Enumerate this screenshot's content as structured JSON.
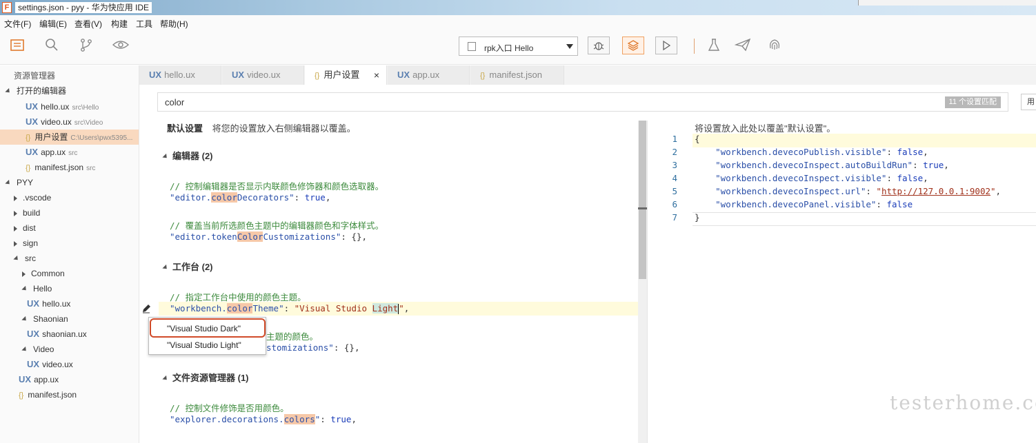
{
  "window": {
    "title": "settings.json - pyy - 华为快应用 IDE",
    "app_icon": "F"
  },
  "menu": [
    "文件(F)",
    "编辑(E)",
    "查看(V)",
    "构建",
    "工具",
    "帮助(H)"
  ],
  "toolbar": {
    "run_target": "rpk入口 Hello",
    "icons": [
      "explorer-icon",
      "search-icon",
      "source-control-icon",
      "preview-eye-icon",
      "debug-bug-icon",
      "layers-icon",
      "run-play-icon",
      "flask-icon",
      "send-icon",
      "fingerprint-icon"
    ]
  },
  "sidebar": {
    "title": "资源管理器",
    "open_editors_label": "打开的编辑器",
    "open_editors": [
      {
        "type": "ux",
        "name": "hello.ux",
        "hint": "src\\Hello"
      },
      {
        "type": "ux",
        "name": "video.ux",
        "hint": "src\\Video"
      },
      {
        "type": "json",
        "name": "用户设置",
        "hint": "C:\\Users\\pwx5395..."
      },
      {
        "type": "ux",
        "name": "app.ux",
        "hint": "src"
      },
      {
        "type": "json",
        "name": "manifest.json",
        "hint": "src"
      }
    ],
    "project": "PYY",
    "tree": [
      ".vscode",
      "build",
      "dist",
      "sign",
      "src",
      "Common",
      "Hello",
      "hello.ux",
      "Shaonian",
      "shaonian.ux",
      "Video",
      "video.ux",
      "app.ux",
      "manifest.json"
    ]
  },
  "tabs": [
    {
      "type": "ux",
      "label": "hello.ux"
    },
    {
      "type": "ux",
      "label": "video.ux"
    },
    {
      "type": "json",
      "label": "用户设置"
    },
    {
      "type": "ux",
      "label": "app.ux"
    },
    {
      "type": "json",
      "label": "manifest.json"
    }
  ],
  "close_glyph": "×",
  "search": {
    "value": "color",
    "badge": "11 个设置匹配",
    "right_button": "用"
  },
  "left_editor": {
    "header_bold": "默认设置",
    "header_text": "将您的设置放入右侧编辑器以覆盖。",
    "sections": [
      {
        "title": "编辑器 (2)"
      },
      {
        "title": "工作台 (2)"
      },
      {
        "title": "文件资源管理器 (1)"
      }
    ],
    "comments": [
      "// 控制编辑器是否显示内联颜色修饰器和颜色选取器。",
      "// 覆盖当前所选颜色主题中的编辑器颜色和字体样式。",
      "// 指定工作台中使用的颜色主题。",
      "主题的颜色。",
      "// 控制文件修饰是否用颜色。"
    ],
    "code": {
      "l1_key_a": "\"editor.",
      "l1_hl": "color",
      "l1_key_b": "Decorators\"",
      "l1_rest": ": ",
      "l1_val": "true",
      "l1_end": ",",
      "l2_key_a": "\"editor.token",
      "l2_hl": "Color",
      "l2_key_b": "Customizations\"",
      "l2_rest": ": {},",
      "l3_key_a": "\"workbench.",
      "l3_hl": "color",
      "l3_key_b": "Theme\"",
      "l3_rest": ": ",
      "l3_str_a": "\"Visual Studio ",
      "l3_str_hl": "Light",
      "l3_str_b": "\"",
      "l3_end": ",",
      "l4_key": "stomizations\"",
      "l4_rest": ": {},",
      "l5_key_a": "\"explorer.decorations.",
      "l5_hl": "colors",
      "l5_key_b": "\"",
      "l5_rest": ": ",
      "l5_val": "true",
      "l5_end": ","
    }
  },
  "dropdown": {
    "options": [
      "\"Visual Studio Dark\"",
      "\"Visual Studio Light\""
    ],
    "selected": 0
  },
  "right_editor": {
    "header": "将设置放入此处以覆盖\"默认设置\"。",
    "line_numbers": [
      "1",
      "2",
      "3",
      "4",
      "5",
      "6",
      "7"
    ],
    "open_brace": "{",
    "close_brace": "}",
    "entries": [
      {
        "key": "\"workbench.devecoPublish.visible\"",
        "value": "false",
        "comma": ","
      },
      {
        "key": "\"workbench.devecoInspect.autoBuildRun\"",
        "value": "true",
        "comma": ","
      },
      {
        "key": "\"workbench.devecoInspect.visible\"",
        "value": "false",
        "comma": ","
      },
      {
        "key": "\"workbench.devecoInspect.url\"",
        "value": "\"http://127.0.0.1:9002\"",
        "comma": ","
      },
      {
        "key": "\"workbench.devecoPanel.visible\"",
        "value": "false",
        "comma": ""
      }
    ],
    "url_text": "http://127.0.0.1:9002"
  },
  "watermark": "testerhome.com"
}
